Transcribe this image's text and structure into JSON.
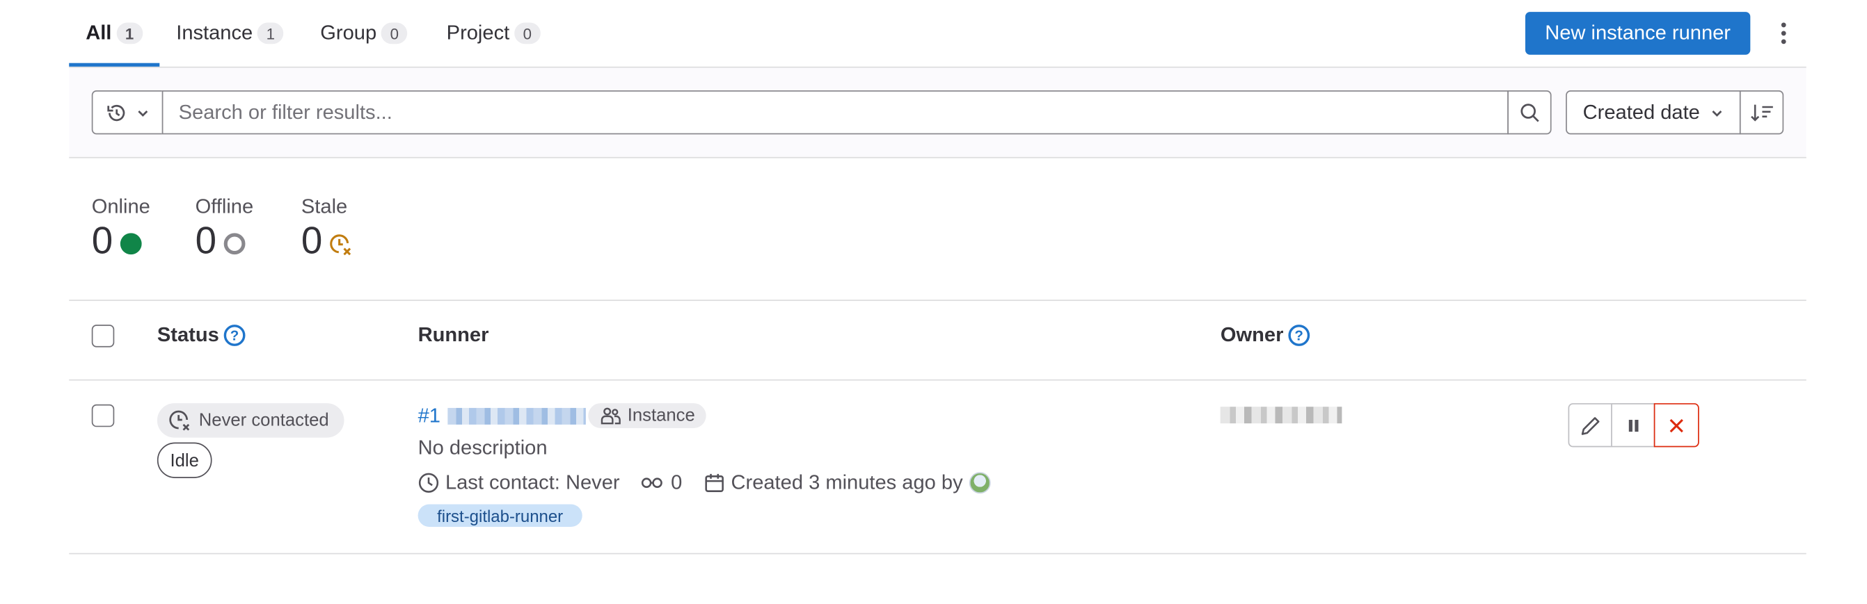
{
  "tabs": [
    {
      "label": "All",
      "count": "1"
    },
    {
      "label": "Instance",
      "count": "1"
    },
    {
      "label": "Group",
      "count": "0"
    },
    {
      "label": "Project",
      "count": "0"
    }
  ],
  "header": {
    "new_runner_label": "New instance runner"
  },
  "filter": {
    "search_placeholder": "Search or filter results...",
    "sort_label": "Created date"
  },
  "stats": {
    "online": {
      "label": "Online",
      "value": "0"
    },
    "offline": {
      "label": "Offline",
      "value": "0"
    },
    "stale": {
      "label": "Stale",
      "value": "0"
    }
  },
  "table": {
    "headers": {
      "status": "Status",
      "runner": "Runner",
      "owner": "Owner"
    },
    "help_glyph": "?",
    "rows": [
      {
        "status_badge": "Never contacted",
        "state_badge": "Idle",
        "runner_id": "#1",
        "type_badge": "Instance",
        "description": "No description",
        "last_contact": "Last contact: Never",
        "jobs_count": "0",
        "created": "Created 3 minutes ago by",
        "tag": "first-gitlab-runner"
      }
    ]
  },
  "colors": {
    "primary": "#1f75cb",
    "online": "#108548",
    "stale": "#c17d10",
    "danger": "#dd2b0e"
  },
  "icons": [
    "history-icon",
    "chevron-down-icon",
    "search-icon",
    "sort-lowest-icon",
    "kebab-icon",
    "clock-x-icon",
    "users-icon",
    "clock-icon",
    "pipeline-icon",
    "calendar-icon",
    "pencil-icon",
    "pause-icon",
    "close-icon"
  ]
}
